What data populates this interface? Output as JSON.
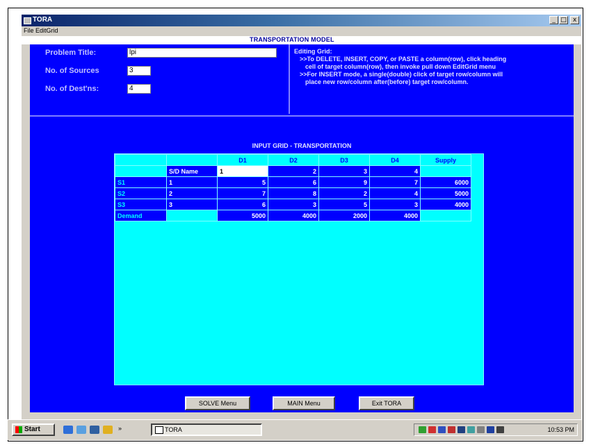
{
  "window": {
    "title": "TORA",
    "controls": [
      "_",
      "□",
      "x"
    ]
  },
  "menu": [
    "File",
    "EditGrid"
  ],
  "caption": "TRANSPORTATION MODEL",
  "form": {
    "problem_title_label": "Problem Title:",
    "problem_title_value": "lpi",
    "sources_label": "No. of Sources",
    "sources_value": "3",
    "dest_label": "No. of Dest'ns:",
    "dest_value": "4"
  },
  "help": {
    "heading": "Editing Grid:",
    "lines": [
      ">>To DELETE, INSERT, COPY, or PASTE a column(row), click heading",
      "cell of target column(row), then invoke pull down EditGrid menu",
      ">>For INSERT mode, a single(double) click of target row/column will",
      "place new row/column after(before) target row/column."
    ]
  },
  "grid": {
    "title": "INPUT GRID - TRANSPORTATION",
    "columns": [
      "",
      "",
      "D1",
      "D2",
      "D3",
      "D4",
      "Supply"
    ],
    "name_row": [
      "",
      "S/D Name",
      "1",
      "2",
      "3",
      "4",
      ""
    ],
    "rows": [
      [
        "S1",
        "1",
        "5",
        "6",
        "9",
        "7",
        "6000"
      ],
      [
        "S2",
        "2",
        "7",
        "8",
        "2",
        "4",
        "5000"
      ],
      [
        "S3",
        "3",
        "6",
        "3",
        "5",
        "3",
        "4000"
      ]
    ],
    "demand": [
      "Demand",
      "",
      "5000",
      "4000",
      "2000",
      "4000",
      ""
    ]
  },
  "buttons": {
    "solve": "SOLVE Menu",
    "main": "MAIN Menu",
    "exit": "Exit TORA"
  },
  "taskbar": {
    "start": "Start",
    "task": "TORA",
    "clock": "10:53 PM",
    "chevron": "»"
  }
}
